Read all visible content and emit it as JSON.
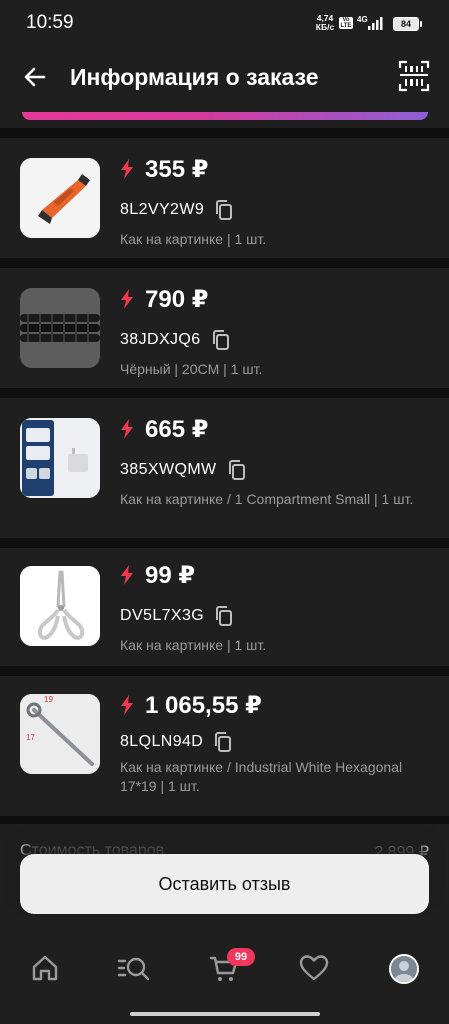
{
  "status_bar": {
    "time": "10:59",
    "net_speed_value": "4,74",
    "net_speed_unit": "КБ/с",
    "network_type": "4G",
    "battery": "84"
  },
  "header": {
    "title": "Информация о заказе"
  },
  "items": [
    {
      "price": "355 ₽",
      "sku": "8L2VY2W9",
      "details": "Как на картинке | 1 шт."
    },
    {
      "price": "790 ₽",
      "sku": "38JDXJQ6",
      "details": "Чёрный | 20CM | 1 шт."
    },
    {
      "price": "665 ₽",
      "sku": "385XWQMW",
      "details": "Как на картинке / 1 Compartment Small | 1 шт."
    },
    {
      "price": "99 ₽",
      "sku": "DV5L7X3G",
      "details": "Как на картинке | 1 шт."
    },
    {
      "price": "1 065,55 ₽",
      "sku": "8LQLN94D",
      "details": "Как на картинке / Industrial White Hexagonal 17*19 | 1 шт."
    }
  ],
  "summary": {
    "goods_cost_label": "Стоимость товаров",
    "goods_cost_value": "2 899 ₽"
  },
  "review_button": "Оставить отзыв",
  "bottom_nav": {
    "cart_badge": "99"
  },
  "colors": {
    "background": "#0f0f0f",
    "card": "#1f1f1f",
    "accent_bolt": "#f0384f",
    "secondary_text": "#9a9a9a",
    "badge": "#f1375e"
  },
  "icons": {
    "back": "arrow-left-icon",
    "barcode": "barcode-icon",
    "price": "lightning-icon",
    "copy": "copy-icon",
    "home": "home-icon",
    "catalog": "catalog-search-icon",
    "cart": "cart-icon",
    "favorites": "heart-icon",
    "profile": "avatar"
  }
}
